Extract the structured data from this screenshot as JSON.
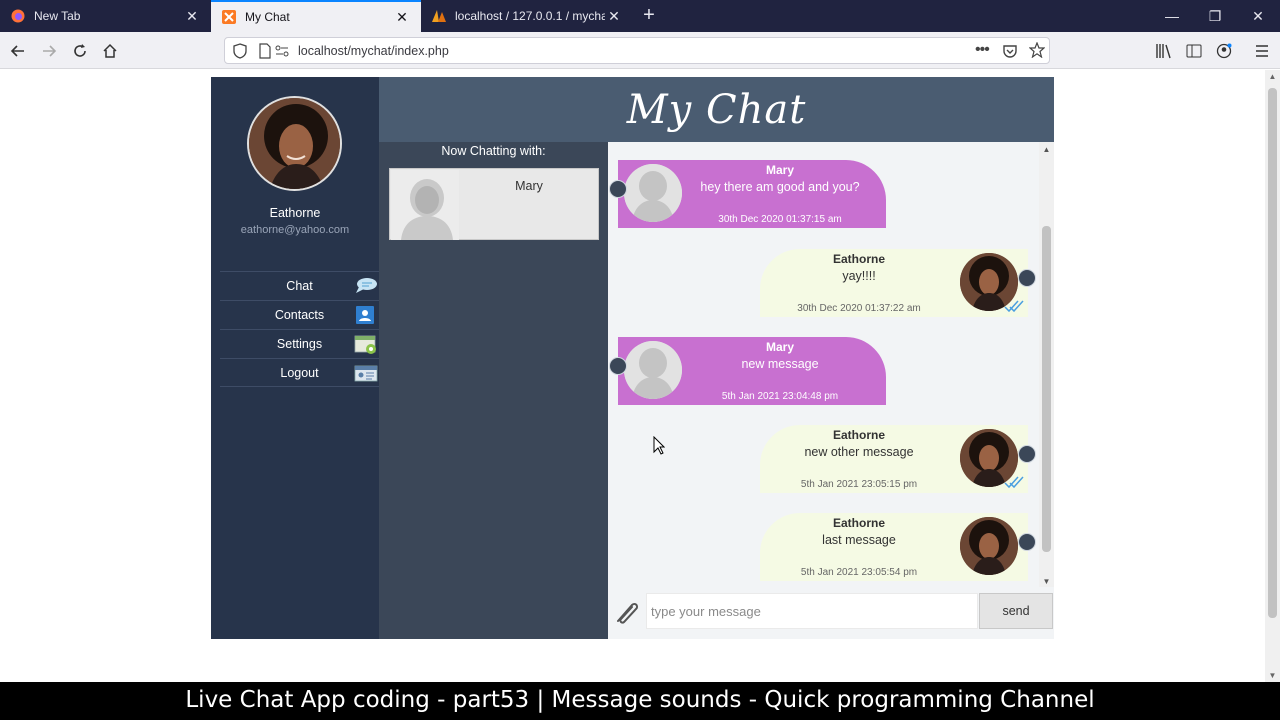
{
  "browser": {
    "tabs": [
      {
        "label": "New Tab",
        "icon": "firefox-icon"
      },
      {
        "label": "My Chat",
        "icon": "xampp-icon",
        "active": true
      },
      {
        "label": "localhost / 127.0.0.1 / mychat_",
        "icon": "phpmyadmin-icon"
      }
    ],
    "url": "localhost/mychat/index.php"
  },
  "app": {
    "title": "My Chat",
    "user": {
      "name": "Eathorne",
      "email": "eathorne@yahoo.com"
    },
    "menu": [
      {
        "label": "Chat",
        "icon": "chat-bubble-icon"
      },
      {
        "label": "Contacts",
        "icon": "contacts-card-icon"
      },
      {
        "label": "Settings",
        "icon": "settings-icon"
      },
      {
        "label": "Logout",
        "icon": "logout-icon"
      }
    ],
    "now_chatting": {
      "heading": "Now Chatting with:",
      "contact_name": "Mary"
    },
    "messages": [
      {
        "side": "left",
        "name": "Mary",
        "text": "hey there am good and you?",
        "time": "30th Dec 2020 01:37:15 am"
      },
      {
        "side": "right",
        "name": "Eathorne",
        "text": "yay!!!!",
        "time": "30th Dec 2020 01:37:22 am",
        "read": true
      },
      {
        "side": "left",
        "name": "Mary",
        "text": "new message",
        "time": "5th Jan 2021 23:04:48 pm"
      },
      {
        "side": "right",
        "name": "Eathorne",
        "text": "new other message",
        "time": "5th Jan 2021 23:05:15 pm",
        "read": true
      },
      {
        "side": "right",
        "name": "Eathorne",
        "text": "last message",
        "time": "5th Jan 2021 23:05:54 pm",
        "read": false
      }
    ],
    "compose": {
      "placeholder": "type your message",
      "send_label": "send"
    },
    "colors": {
      "sidebar": "#27344b",
      "header": "#4a5c71",
      "incoming": "#c870d0",
      "outgoing": "#f5fae4"
    }
  },
  "caption": "Live Chat App coding - part53 | Message sounds - Quick programming Channel"
}
